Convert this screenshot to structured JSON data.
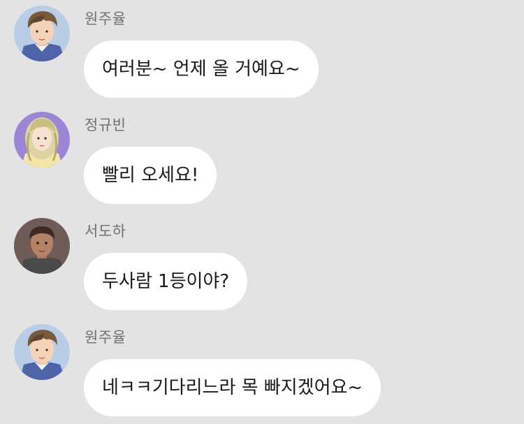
{
  "messages": [
    {
      "sender": "원주율",
      "avatar_icon": "boy-brown-hair-avatar",
      "text": "여러분~ 언제 올 거예요~"
    },
    {
      "sender": "정규빈",
      "avatar_icon": "girl-blonde-hair-avatar",
      "text": "빨리 오세요!"
    },
    {
      "sender": "서도하",
      "avatar_icon": "boy-dark-skin-avatar",
      "text": "두사람 1등이야?"
    },
    {
      "sender": "원주율",
      "avatar_icon": "boy-brown-hair-avatar",
      "text": "네ㅋㅋ기다리느라 목 빠지겠어요~"
    }
  ],
  "colors": {
    "background": "#e3e3e3",
    "bubble": "#ffffff",
    "sender_name": "#707070",
    "message_text": "#1a1a1a"
  }
}
